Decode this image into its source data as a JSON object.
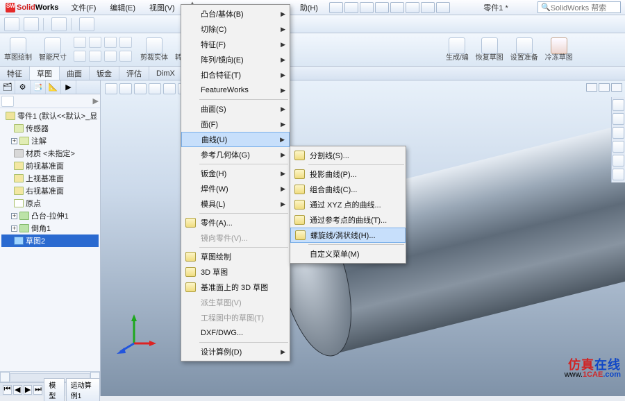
{
  "app": {
    "name_left": "Solid",
    "name_right": "Works",
    "title_doc": "零件1 *",
    "search_placeholder": "SolidWorks 帮索"
  },
  "menubar": [
    "文件(F)",
    "编辑(E)",
    "视图(V)",
    "助(H)"
  ],
  "mainmenu": {
    "items": [
      {
        "label": "凸台/基体(B)",
        "arrow": true
      },
      {
        "label": "切除(C)",
        "arrow": true
      },
      {
        "label": "特征(F)",
        "arrow": true
      },
      {
        "label": "阵列/镜向(E)",
        "arrow": true
      },
      {
        "label": "扣合特征(T)",
        "arrow": true
      },
      {
        "label": "FeatureWorks",
        "arrow": true
      },
      {
        "sep": true
      },
      {
        "label": "曲面(S)",
        "arrow": true
      },
      {
        "label": "面(F)",
        "arrow": true
      },
      {
        "label": "曲线(U)",
        "arrow": true,
        "hi": true
      },
      {
        "label": "参考几何体(G)",
        "arrow": true
      },
      {
        "sep": true
      },
      {
        "label": "钣金(H)",
        "arrow": true
      },
      {
        "label": "焊件(W)",
        "arrow": true
      },
      {
        "label": "模具(L)",
        "arrow": true
      },
      {
        "sep": true
      },
      {
        "label": "零件(A)...",
        "icon": true
      },
      {
        "label": "镜向零件(V)...",
        "disabled": true
      },
      {
        "sep": true
      },
      {
        "label": "草图绘制",
        "icon": true
      },
      {
        "label": "3D 草图",
        "icon": true
      },
      {
        "label": "基准面上的 3D 草图",
        "icon": true
      },
      {
        "label": "派生草图(V)",
        "disabled": true
      },
      {
        "label": "工程图中的草图(T)",
        "disabled": true
      },
      {
        "label": "DXF/DWG..."
      },
      {
        "sep": true
      },
      {
        "label": "设计算例(D)",
        "arrow": true
      }
    ]
  },
  "submenu": {
    "items": [
      {
        "label": "分割线(S)...",
        "icon": true
      },
      {
        "sep": true
      },
      {
        "label": "投影曲线(P)...",
        "icon": true
      },
      {
        "label": "组合曲线(C)...",
        "icon": true
      },
      {
        "label": "通过 XYZ 点的曲线...",
        "icon": true
      },
      {
        "label": "通过参考点的曲线(T)...",
        "icon": true
      },
      {
        "label": "螺旋线/涡状线(H)...",
        "icon": true,
        "hi": true
      },
      {
        "sep": true
      },
      {
        "label": "自定义菜单(M)"
      }
    ]
  },
  "tabs": [
    "特征",
    "草图",
    "曲面",
    "钣金",
    "评估",
    "DimX"
  ],
  "ribbon": {
    "big": [
      "草图绘制",
      "智能尺寸"
    ],
    "rightbig": [
      "生成/编",
      "恢复草图",
      "设置准备",
      "冷冻草图"
    ]
  },
  "tree": {
    "root": "零件1 (默认<<默认>_显",
    "nodes": [
      {
        "t": "传感器"
      },
      {
        "t": "注解",
        "exp": "+"
      },
      {
        "t": "材质 <未指定>"
      },
      {
        "t": "前视基准面"
      },
      {
        "t": "上视基准面"
      },
      {
        "t": "右视基准面"
      },
      {
        "t": "原点"
      },
      {
        "t": "凸台-拉伸1",
        "exp": "+"
      },
      {
        "t": "倒角1",
        "exp": "+"
      },
      {
        "t": "草图2",
        "sel": true
      }
    ]
  },
  "bottomtabs": {
    "tab1": "模型",
    "tab2": "运动算例1"
  },
  "sponsor": {
    "cn1": "仿真",
    "cn2": "在线",
    "url1": "www.",
    "url2": "1CAE",
    "url3": ".com"
  },
  "watermark": "1CAE.com"
}
